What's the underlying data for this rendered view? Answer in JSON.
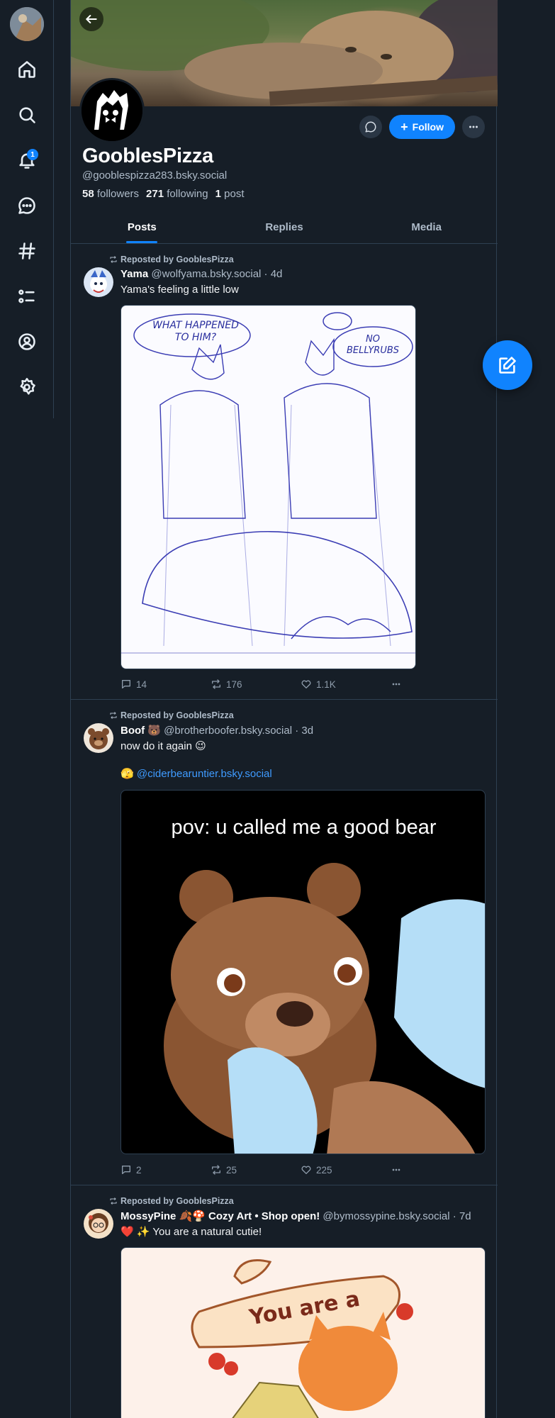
{
  "sidebar": {
    "notification_count": "1",
    "items": [
      {
        "icon": "home-icon"
      },
      {
        "icon": "search-icon"
      },
      {
        "icon": "bell-icon"
      },
      {
        "icon": "chat-icon"
      },
      {
        "icon": "hashtag-icon"
      },
      {
        "icon": "list-icon"
      },
      {
        "icon": "profile-icon"
      },
      {
        "icon": "gear-icon"
      }
    ]
  },
  "profile": {
    "display_name": "GooblesPizza",
    "handle": "@gooblespizza283.bsky.social",
    "followers_count": "58",
    "followers_label": "followers",
    "following_count": "271",
    "following_label": "following",
    "posts_count": "1",
    "posts_label": "post",
    "follow_label": "Follow"
  },
  "tabs": [
    {
      "label": "Posts",
      "active": true
    },
    {
      "label": "Replies",
      "active": false
    },
    {
      "label": "Media",
      "active": false
    }
  ],
  "posts": [
    {
      "repost_label": "Reposted by GooblesPizza",
      "author": "Yama",
      "handle": "@wolfyama.bsky.social",
      "time": "· 4d",
      "text": "Yama's feeling a little low",
      "image_caption_left": "WHAT HAPPENED TO HIM?",
      "image_caption_right": "NO BELLYRUBS",
      "replies": "14",
      "reposts": "176",
      "likes": "1.1K"
    },
    {
      "repost_label": "Reposted by GooblesPizza",
      "author": "Boof 🐻",
      "handle": "@brotherboofer.bsky.social",
      "time": "· 3d",
      "text": "now do it again 😉",
      "link_prefix": "🫣",
      "link": "@ciderbearuntier.bsky.social",
      "image_caption": "pov: u called me a good bear",
      "replies": "2",
      "reposts": "25",
      "likes": "225"
    },
    {
      "repost_label": "Reposted by GooblesPizza",
      "author": "MossyPine 🍂🍄 Cozy Art • Shop open!",
      "handle": "@bymossypine.bsky.social",
      "time": "· 7d",
      "text": "❤️ ✨ You are a natural cutie!",
      "image_caption": "You are a"
    }
  ],
  "colors": {
    "background": "#161e27",
    "accent": "#1083fe",
    "border": "#2e4052",
    "muted_text": "#aebbc9"
  }
}
